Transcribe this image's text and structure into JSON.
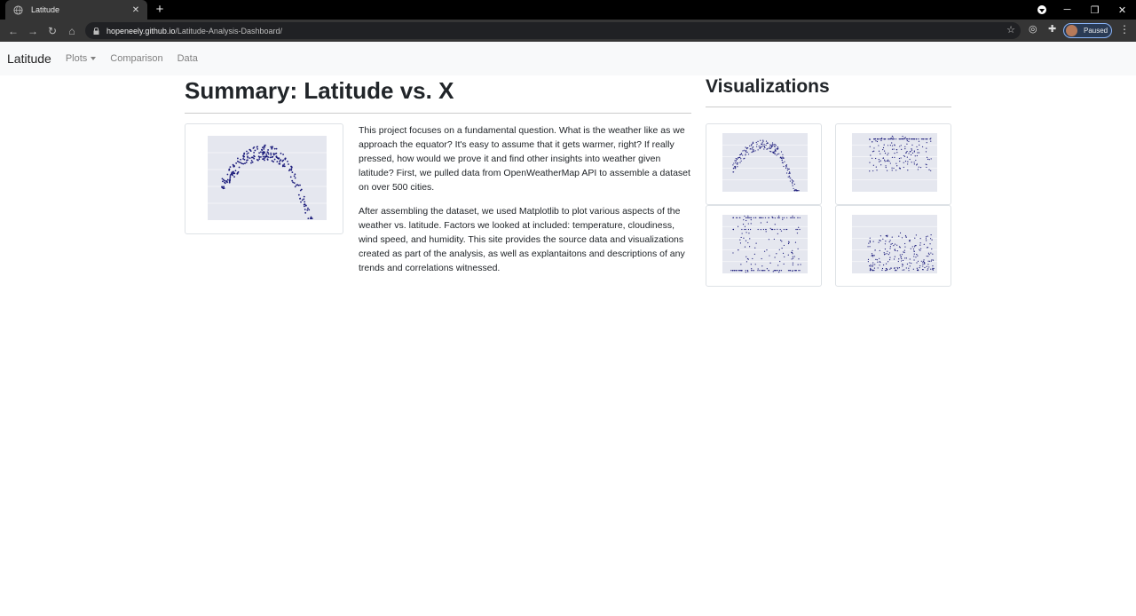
{
  "browser": {
    "tab_title": "Latitude",
    "url_host": "hopeneely.github.io",
    "url_path": "/Latitude-Analysis-Dashboard/",
    "profile_status": "Paused"
  },
  "navbar": {
    "brand": "Latitude",
    "links": [
      "Plots",
      "Comparison",
      "Data"
    ]
  },
  "summary": {
    "title": "Summary: Latitude vs. X",
    "paragraphs": [
      "This project focuses on a fundamental question. What is the weather like as we approach the equator? It's easy to assume that it gets warmer, right? If really pressed, how would we prove it and find other insights into weather given latitude? First, we pulled data from OpenWeatherMap API to assemble a dataset on over 500 cities.",
      "After assembling the dataset, we used Matplotlib to plot various aspects of the weather vs. latitude. Factors we looked at included: temperature, cloudiness, wind speed, and humidity. This site provides the source data and visualizations created as part of the analysis, as well as explantaitons and descriptions of any trends and correlations witnessed."
    ]
  },
  "visualizations": {
    "title": "Visualizations"
  },
  "colors": {
    "navbar_bg": "#f8f9fa",
    "plot_bg": "#e5e7ef",
    "points": "#1a1a7a"
  }
}
